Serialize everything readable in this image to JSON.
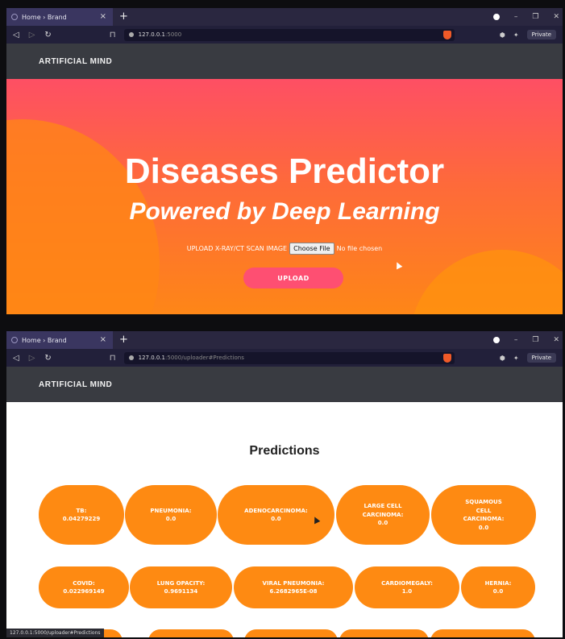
{
  "browser": {
    "tab_title": "Home › Brand",
    "tab_close": "×",
    "new_tab": "+",
    "private_label": "Private",
    "url_host": "127.0.0.1",
    "url_path_home": ":5000",
    "url_path_predict": ":5000/uploader#Predictions",
    "status_url": "127.0.0.1:5000/uploader#Predictions"
  },
  "site": {
    "brand": "ARTIFICIAL MIND"
  },
  "hero": {
    "title": "Diseases Predictor",
    "subtitle": "Powered by Deep Learning",
    "upload_label": "UPLOAD X-RAY/CT SCAN IMAGE",
    "choose_file": "Choose File",
    "no_file": "No file chosen",
    "upload_button": "UPLOAD"
  },
  "predictions": {
    "title": "Predictions",
    "row1": [
      {
        "name": "TB:",
        "value": "0.04279229"
      },
      {
        "name": "PNEUMONIA:",
        "value": "0.0"
      },
      {
        "name": "ADENOCARCINOMA:",
        "value": "0.0"
      },
      {
        "name": "LARGE CELL CARCINOMA:",
        "value": "0.0"
      },
      {
        "name": "SQUAMOUS CELL CARCINOMA:",
        "value": "0.0"
      }
    ],
    "row2": [
      {
        "name": "COVID:",
        "value": "0.022969149"
      },
      {
        "name": "LUNG OPACITY:",
        "value": "0.9691134"
      },
      {
        "name": "VIRAL PNEUMONIA:",
        "value": "6.2682965E-08"
      },
      {
        "name": "CARDIOMEGALY:",
        "value": "1.0"
      },
      {
        "name": "HERNIA:",
        "value": "0.0"
      }
    ]
  }
}
